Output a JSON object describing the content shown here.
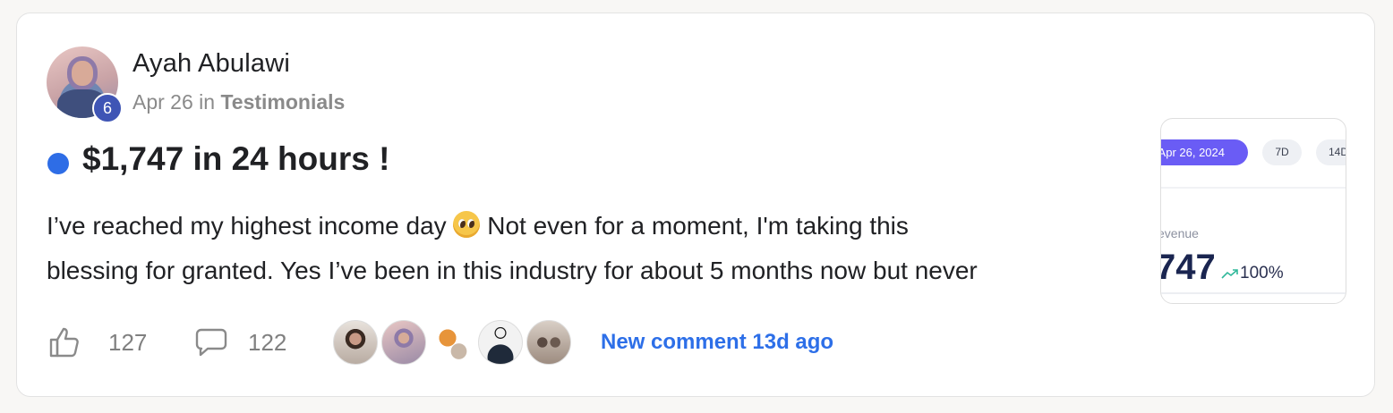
{
  "post": {
    "author": "Ayah Abulawi",
    "level": "6",
    "date": "Apr 26",
    "in_word": "in",
    "category": "Testimonials",
    "title": "$1,747 in 24 hours !",
    "body_line1_before_emoji": "I’ve reached my highest income day ",
    "body_line1_after_emoji": " Not even for a moment, I'm taking this",
    "body_line2": "blessing for granted. Yes I’ve been in this industry for about 5 months now but never",
    "emoji_icon": "pleading-face-icon",
    "unread_color": "#2e6de6"
  },
  "thumbnail": {
    "date_range": "- Apr 26, 2024",
    "range_7d": "7D",
    "range_14d": "14D",
    "revenue_label": "evenue",
    "revenue_value": "747",
    "trend_pct": "100%",
    "accent": "#6a5cf5"
  },
  "footer": {
    "likes": "127",
    "comments": "122",
    "new_comment": "New comment 13d ago",
    "link_color": "#2d6fe8"
  }
}
